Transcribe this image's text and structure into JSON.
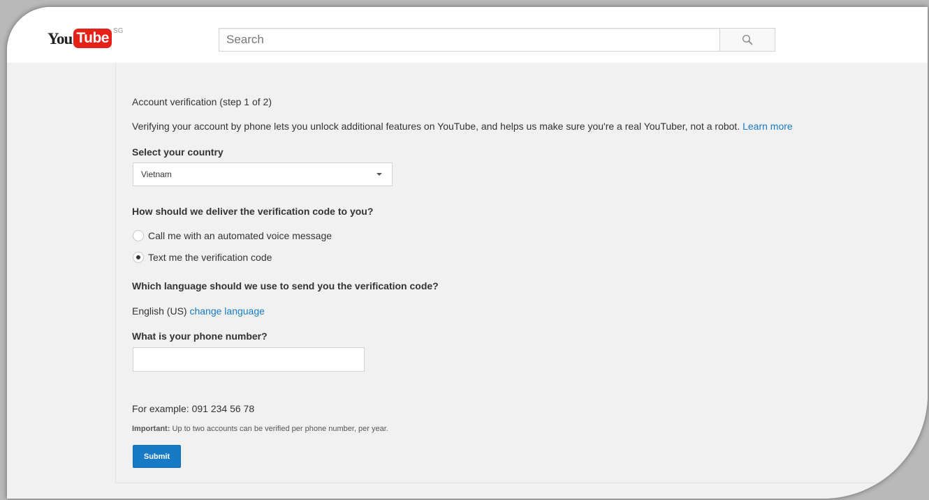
{
  "header": {
    "logo_you": "You",
    "logo_tube": "Tube",
    "logo_region": "SG",
    "search_placeholder": "Search"
  },
  "form": {
    "title": "Account verification (step 1 of 2)",
    "intro": "Verifying your account by phone lets you unlock additional features on YouTube, and helps us make sure you're a real YouTuber, not a robot.",
    "learn_more": "Learn more",
    "country_label": "Select your country",
    "country_value": "Vietnam",
    "delivery_label": "How should we deliver the verification code to you?",
    "delivery_options": [
      {
        "label": "Call me with an automated voice message",
        "selected": false
      },
      {
        "label": "Text me the verification code",
        "selected": true
      }
    ],
    "language_label": "Which language should we use to send you the verification code?",
    "language_value": "English (US)",
    "change_language": "change language",
    "phone_label": "What is your phone number?",
    "phone_value": "",
    "example": "For example: 091 234 56 78",
    "important_label": "Important:",
    "important_text": "Up to two accounts can be verified per phone number, per year.",
    "submit": "Submit"
  },
  "colors": {
    "brand_red": "#e62117",
    "link_blue": "#167ac6",
    "background": "#f1f1f1"
  },
  "icons": {
    "search": "search-icon",
    "dropdown": "chevron-down-icon"
  }
}
